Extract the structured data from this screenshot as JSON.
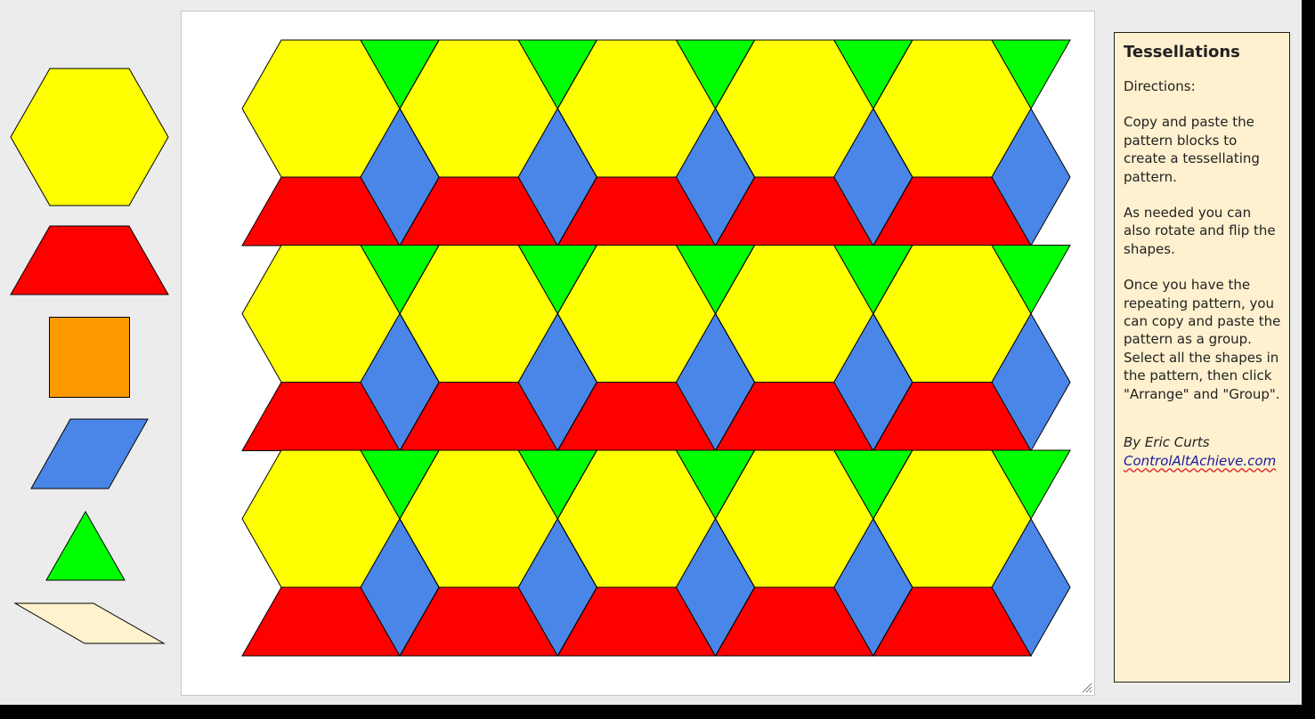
{
  "palette": {
    "blocks": [
      {
        "name": "hexagon",
        "color": "#ffff00"
      },
      {
        "name": "trapezoid",
        "color": "#ff0000"
      },
      {
        "name": "square",
        "color": "#ff9900"
      },
      {
        "name": "blue-rhombus",
        "color": "#4a86e8"
      },
      {
        "name": "triangle",
        "color": "#00ff00"
      },
      {
        "name": "thin-rhombus",
        "color": "#fff2cc"
      }
    ]
  },
  "canvas": {
    "pattern_rows": 3,
    "pattern_columns": 5,
    "colors": {
      "hexagon": "#ffff00",
      "trapezoid": "#ff0000",
      "rhombus": "#4a86e8",
      "triangle": "#00ff00"
    }
  },
  "directions": {
    "title": "Tessellations",
    "heading": "Directions:",
    "paragraph1": "Copy and paste the pattern blocks to create a tessellating pattern.",
    "paragraph2": "As needed you can also rotate and flip the shapes.",
    "paragraph3": "Once you have the repeating pattern, you can copy and paste the pattern as a group. Select all the shapes in the pattern, then click \"Arrange\" and \"Group\".",
    "author": "By Eric Curts",
    "website": "ControlAltAchieve.com"
  }
}
